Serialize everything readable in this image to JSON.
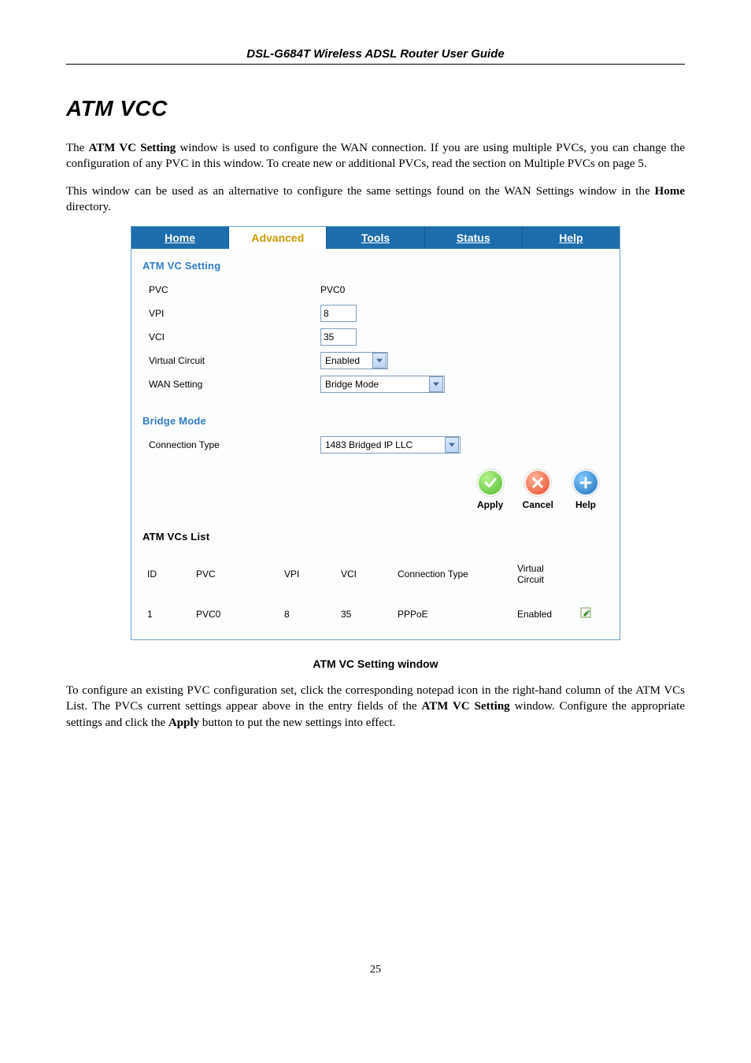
{
  "doc": {
    "running_head": "DSL-G684T Wireless ADSL Router User Guide",
    "title": "ATM VCC",
    "p1_a": "The ",
    "p1_b": "ATM VC Setting",
    "p1_c": " window is used to configure the WAN connection. If you are using multiple PVCs, you can change the configuration of any PVC in this window. To create new or additional PVCs, read the section on Multiple PVCs on page 5.",
    "p2_a": "This window can be used as an alternative to configure the same settings found on the WAN Settings window in the ",
    "p2_b": "Home",
    "p2_c": " directory.",
    "caption": "ATM VC Setting window",
    "p3_a": "To configure an existing PVC configuration set, click the corresponding notepad icon in the right-hand column of the ATM VCs List. The PVCs current settings appear above in the entry fields of the ",
    "p3_b": "ATM VC Setting",
    "p3_c": " window. Configure the appropriate settings and click the ",
    "p3_d": "Apply",
    "p3_e": " button to put the new settings into effect.",
    "page_num": "25"
  },
  "nav": {
    "tabs": [
      "Home",
      "Advanced",
      "Tools",
      "Status",
      "Help"
    ]
  },
  "form": {
    "heading1": "ATM VC Setting",
    "pvc_label": "PVC",
    "pvc_value": "PVC0",
    "vpi_label": "VPI",
    "vpi_value": "8",
    "vci_label": "VCI",
    "vci_value": "35",
    "vc_label": "Virtual Circuit",
    "vc_value": "Enabled",
    "wan_label": "WAN Setting",
    "wan_value": "Bridge Mode",
    "heading2": "Bridge Mode",
    "ct_label": "Connection Type",
    "ct_value": "1483 Bridged IP LLC"
  },
  "actions": {
    "apply": "Apply",
    "cancel": "Cancel",
    "help": "Help"
  },
  "vcs": {
    "heading": "ATM VCs List",
    "cols": {
      "id": "ID",
      "pvc": "PVC",
      "vpi": "VPI",
      "vci": "VCI",
      "ct": "Connection Type",
      "vc": "Virtual Circuit"
    },
    "row": {
      "id": "1",
      "pvc": "PVC0",
      "vpi": "8",
      "vci": "35",
      "ct": "PPPoE",
      "vc": "Enabled"
    }
  }
}
